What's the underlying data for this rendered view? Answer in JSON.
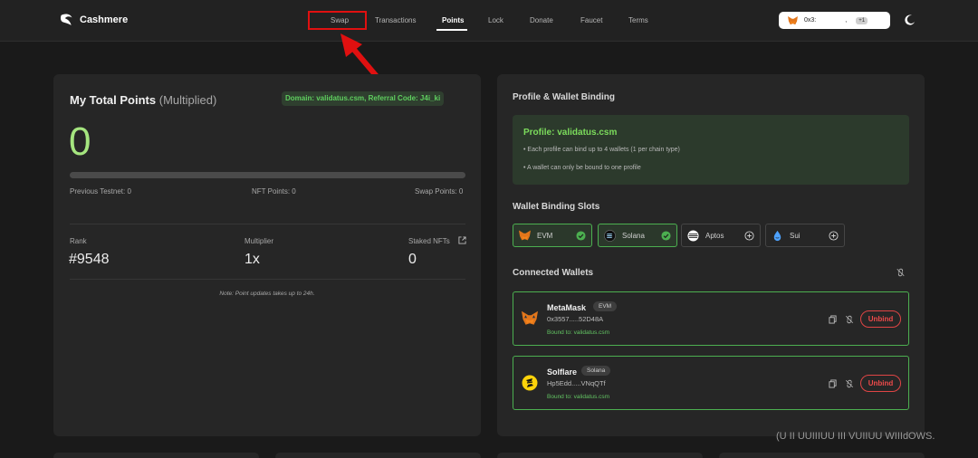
{
  "header": {
    "app_name": "Cashmere",
    "nav": [
      {
        "label": "Swap"
      },
      {
        "label": "Transactions"
      },
      {
        "label": "Points"
      },
      {
        "label": "Lock"
      },
      {
        "label": "Donate"
      },
      {
        "label": "Faucet"
      },
      {
        "label": "Terms"
      }
    ],
    "active_nav": "Points",
    "highlighted_nav": "Swap",
    "wallet": {
      "address": "0x3:",
      "separator": ",",
      "extra_count": "+1"
    }
  },
  "points_card": {
    "title": "My Total Points",
    "title_suffix": "(Multiplied)",
    "domain_badge": "Domain: validatus.csm, Referral Code: J4i_ki",
    "total": "0",
    "progress_fraction": 0,
    "sub_stats": {
      "previous_testnet": "Previous Testnet: 0",
      "nft_points": "NFT Points: 0",
      "swap_points": "Swap Points: 0"
    },
    "stats": {
      "rank_label": "Rank",
      "rank_value": "#9548",
      "multiplier_label": "Multiplier",
      "multiplier_value": "1x",
      "staked_label": "Staked NFTs",
      "staked_value": "0"
    },
    "note": "Note: Point updates takes up to 24h."
  },
  "profile_card": {
    "title": "Profile & Wallet Binding",
    "profile_name": "Profile: validatus.csm",
    "rules": [
      "• Each profile can bind up to 4 wallets (1 per chain type)",
      "• A wallet can only be bound to one profile"
    ],
    "slots_title": "Wallet Binding Slots",
    "slots": [
      {
        "label": "EVM",
        "bound": true
      },
      {
        "label": "Solana",
        "bound": true
      },
      {
        "label": "Aptos",
        "bound": false
      },
      {
        "label": "Sui",
        "bound": false
      }
    ],
    "connected_title": "Connected Wallets",
    "wallets": [
      {
        "name": "MetaMask",
        "chain": "EVM",
        "address": "0x3557.....52D48A",
        "bound_to": "Bound to: validatus.csm",
        "action": "Unbind"
      },
      {
        "name": "Solflare",
        "chain": "Solana",
        "address": "Hp5Edd.....VNqQTf",
        "bound_to": "Bound to: validatus.csm",
        "action": "Unbind"
      }
    ]
  },
  "os_overlay": {
    "text": "(U II UUIIIUU III VUIIUU WIIIdOWS."
  },
  "colors": {
    "background": "#1a1a1a",
    "card": "#262626",
    "accent_green": "#7cdc5c",
    "points_green": "#a5e57f",
    "danger": "#ef4b4b",
    "annotation_red": "#e01010"
  },
  "icons": [
    "cashmere-logo-icon",
    "metamask-fox-icon",
    "moon-icon",
    "external-link-icon",
    "check-circle-icon",
    "plus-circle-icon",
    "solana-icon",
    "aptos-icon",
    "sui-icon",
    "unlink-icon",
    "copy-icon",
    "solflare-icon"
  ]
}
